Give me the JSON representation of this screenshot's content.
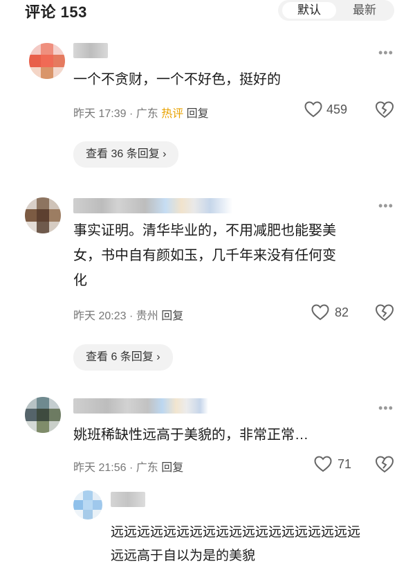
{
  "header": {
    "title": "评论 153",
    "sort_hot": "默认",
    "sort_new": "最新"
  },
  "comments": [
    {
      "text": "一个不贪财，一个不好色，挺好的",
      "time": "昨天 17:39",
      "location": "· 广东",
      "hot_badge": "热评",
      "reply": "回复",
      "likes": "459",
      "view_replies": "查看 36 条回复 ›"
    },
    {
      "text_line1": "事实证明。清华毕业的，不用减肥也能娶美",
      "text_line2": "女，书中自有颜如玉，几千年来没有任何变",
      "text_line3": "化",
      "time": "昨天 20:23",
      "location": "· 贵州",
      "reply": "回复",
      "likes": "82",
      "view_replies": "查看 6 条回复 ›"
    },
    {
      "text": "姚班稀缺性远高于美貌的，非常正常…",
      "time": "昨天 21:56",
      "location": "· 广东",
      "reply": "回复",
      "likes": "71"
    }
  ],
  "sub_reply": {
    "text_line1": "远远远远远远远远远远远远远远远远远远远",
    "text_line2": "远远高于自以为是的美貌"
  },
  "icons": {
    "more": "more-dots-icon",
    "like": "heart-outline-icon",
    "dislike": "broken-heart-icon"
  },
  "colors": {
    "hot_badge": "#e8a200",
    "muted": "#777777",
    "pill_bg": "#f2f2f2"
  }
}
